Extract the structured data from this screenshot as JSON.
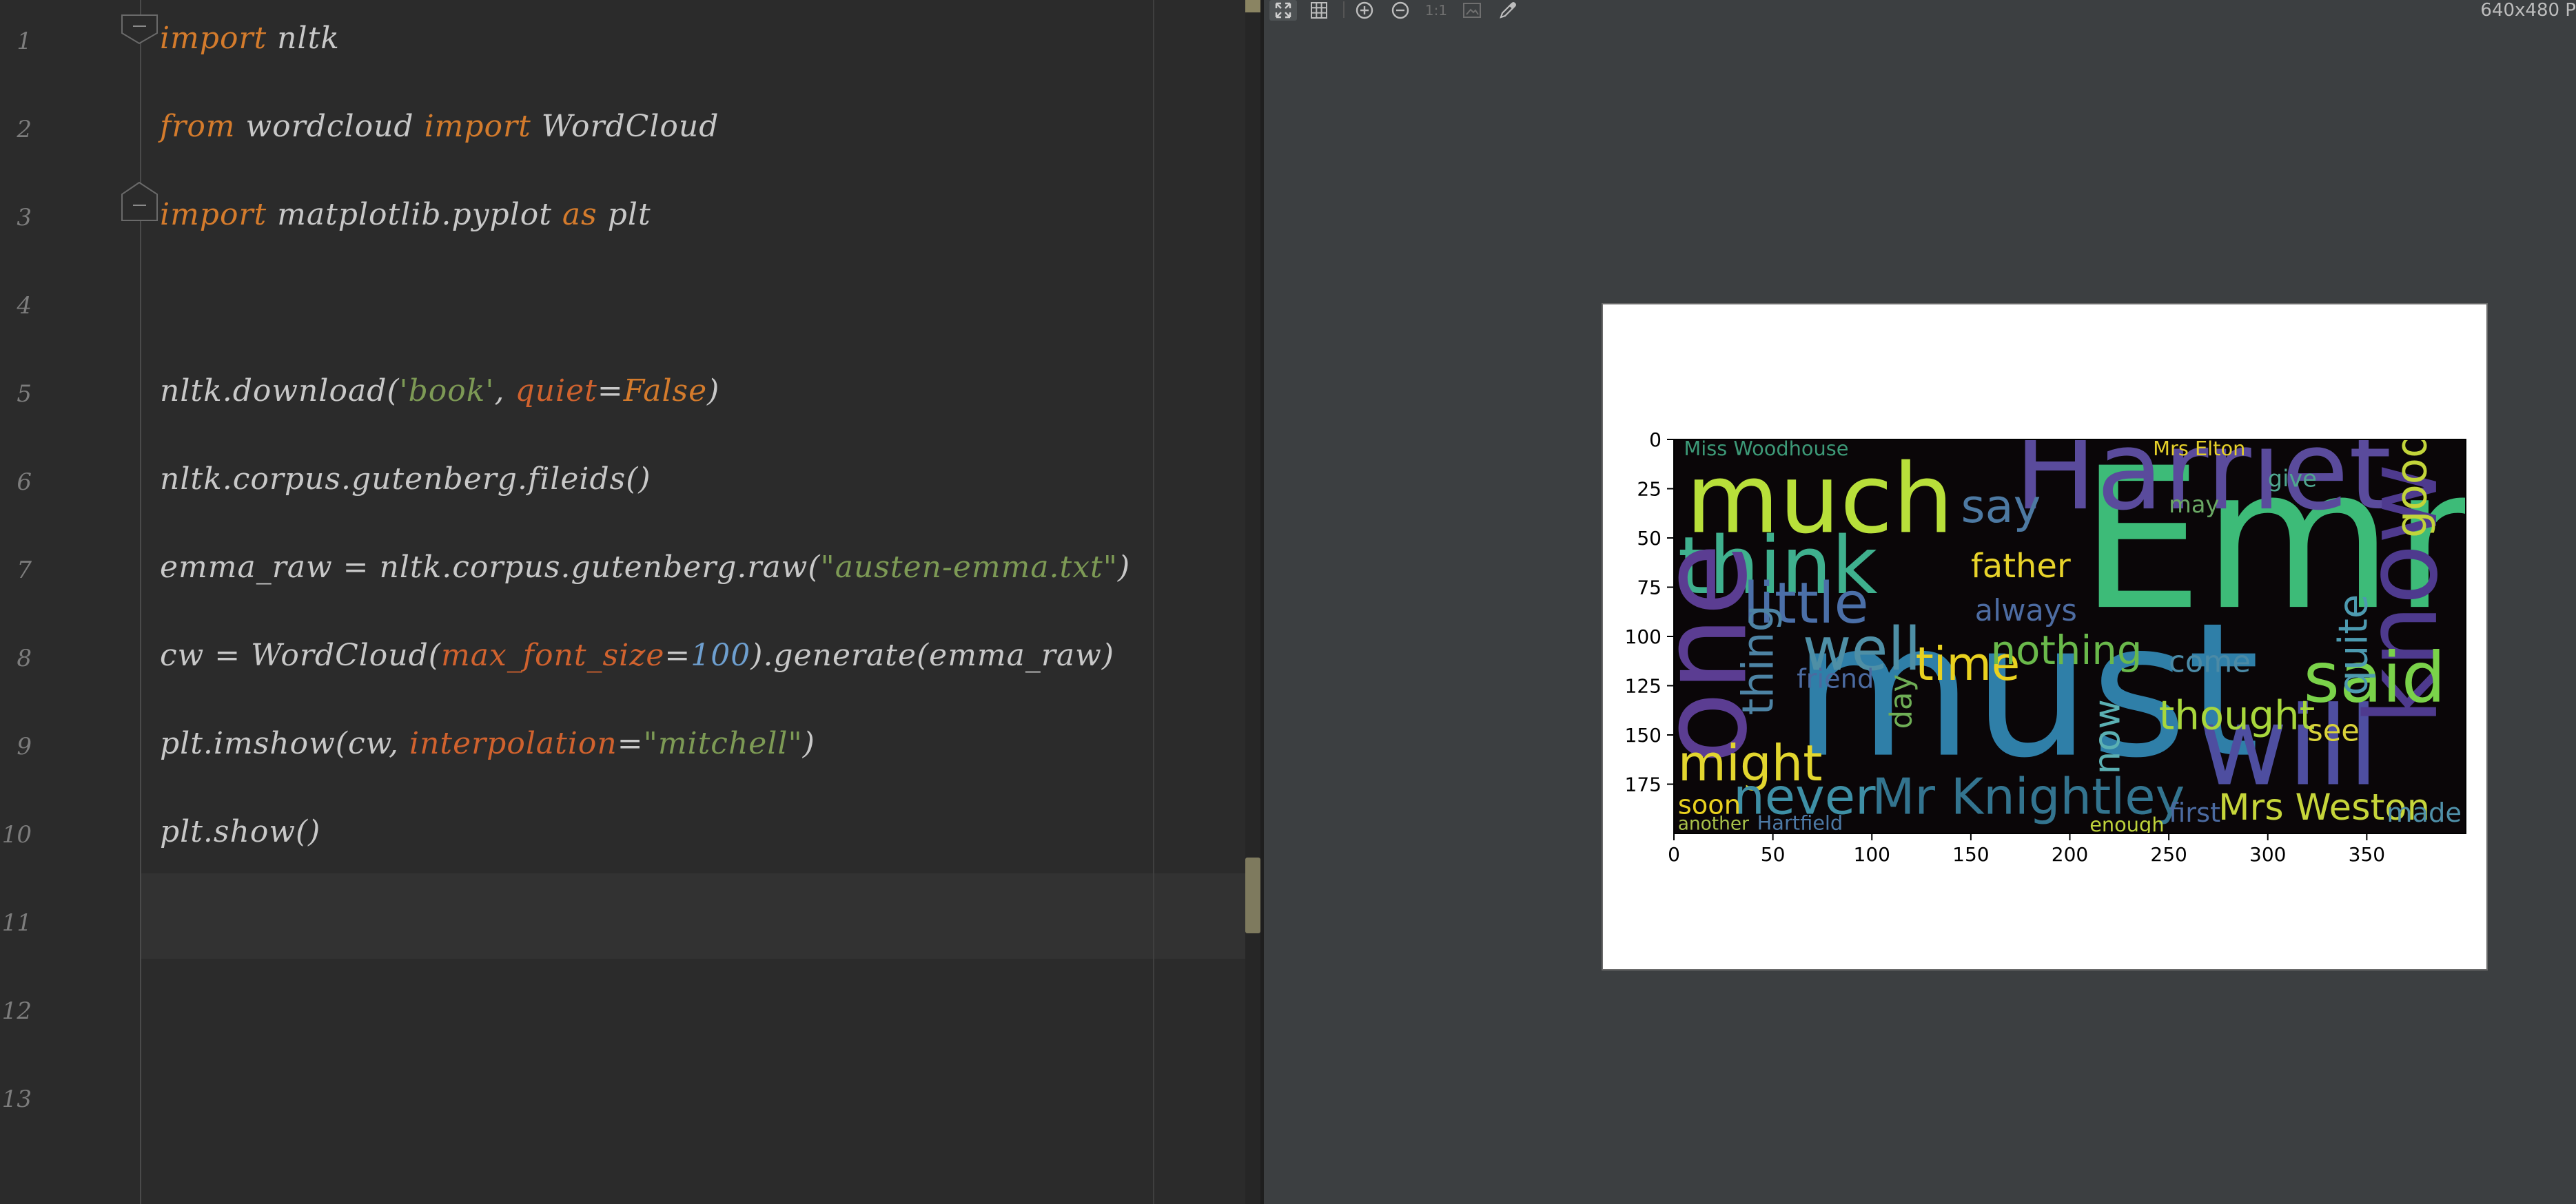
{
  "editor": {
    "line_numbers": [
      "1",
      "2",
      "3",
      "4",
      "5",
      "6",
      "7",
      "8",
      "9",
      "10",
      "11",
      "12",
      "13"
    ],
    "lines": [
      [
        {
          "t": "import",
          "c": "kw"
        },
        {
          "t": " nltk",
          "c": ""
        }
      ],
      [
        {
          "t": "from",
          "c": "kw"
        },
        {
          "t": " wordcloud ",
          "c": ""
        },
        {
          "t": "import",
          "c": "kw"
        },
        {
          "t": " WordCloud",
          "c": ""
        }
      ],
      [
        {
          "t": "import",
          "c": "kw"
        },
        {
          "t": " matplotlib.pyplot ",
          "c": ""
        },
        {
          "t": "as",
          "c": "kw"
        },
        {
          "t": " plt",
          "c": ""
        }
      ],
      [],
      [
        {
          "t": "nltk.download(",
          "c": ""
        },
        {
          "t": "'book'",
          "c": "str"
        },
        {
          "t": ", ",
          "c": ""
        },
        {
          "t": "quiet",
          "c": "prm"
        },
        {
          "t": "=",
          "c": ""
        },
        {
          "t": "False",
          "c": "kw"
        },
        {
          "t": ")",
          "c": ""
        }
      ],
      [
        {
          "t": "nltk.corpus.gutenberg.fileids()",
          "c": ""
        }
      ],
      [
        {
          "t": "emma_raw = nltk.corpus.gutenberg.raw(",
          "c": ""
        },
        {
          "t": "\"austen-emma.txt\"",
          "c": "str"
        },
        {
          "t": ")",
          "c": ""
        }
      ],
      [
        {
          "t": "cw = WordCloud(",
          "c": ""
        },
        {
          "t": "max_font_size",
          "c": "prm"
        },
        {
          "t": "=",
          "c": ""
        },
        {
          "t": "100",
          "c": "num"
        },
        {
          "t": ").generate(emma_raw)",
          "c": ""
        }
      ],
      [
        {
          "t": "plt.imshow(cw, ",
          "c": ""
        },
        {
          "t": "interpolation",
          "c": "prm"
        },
        {
          "t": "=",
          "c": ""
        },
        {
          "t": "\"mitchell\"",
          "c": "str"
        },
        {
          "t": ")",
          "c": ""
        }
      ],
      [
        {
          "t": "plt.show()",
          "c": ""
        }
      ],
      [],
      [],
      []
    ]
  },
  "viewer": {
    "toolbar": {
      "icons": [
        "fit-window-icon",
        "grid-icon",
        "zoom-in-icon",
        "zoom-out-icon",
        "actual-size-icon",
        "background-icon",
        "color-picker-icon"
      ],
      "actual_size_label": "1:1",
      "image_size": "640x480 P"
    }
  },
  "chart_data": {
    "type": "image",
    "content": "word cloud",
    "xlim": [
      0,
      400
    ],
    "ylim": [
      200,
      0
    ],
    "xticks": [
      0,
      50,
      100,
      150,
      200,
      250,
      300,
      350
    ],
    "yticks": [
      0,
      25,
      50,
      75,
      100,
      125,
      150,
      175
    ],
    "words": [
      {
        "text": "Emma",
        "x": 205,
        "y": 85,
        "size": 118,
        "color": "#3dbb78",
        "rot": 0
      },
      {
        "text": "must",
        "x": 60,
        "y": 160,
        "size": 112,
        "color": "#2f7fa8",
        "rot": 0
      },
      {
        "text": "Harriet",
        "x": 172,
        "y": 35,
        "size": 66,
        "color": "#5a4b9c",
        "rot": 0
      },
      {
        "text": "much",
        "x": 6,
        "y": 47,
        "size": 58,
        "color": "#b8df3a",
        "rot": 0
      },
      {
        "text": "think",
        "x": 2,
        "y": 78,
        "size": 48,
        "color": "#3fb08e",
        "rot": 0
      },
      {
        "text": "will",
        "x": 265,
        "y": 175,
        "size": 66,
        "color": "#4e4ea0",
        "rot": 0
      },
      {
        "text": "one",
        "x": 36,
        "y": 165,
        "size": 72,
        "color": "#5b3d92",
        "rot": -90
      },
      {
        "text": "know",
        "x": 385,
        "y": 145,
        "size": 60,
        "color": "#4e3a8e",
        "rot": -90
      },
      {
        "text": "little",
        "x": 35,
        "y": 93,
        "size": 34,
        "color": "#4b6fa8",
        "rot": 0
      },
      {
        "text": "well",
        "x": 65,
        "y": 117,
        "size": 36,
        "color": "#4e8fa6",
        "rot": 0
      },
      {
        "text": "said",
        "x": 318,
        "y": 133,
        "size": 42,
        "color": "#7ad24a",
        "rot": 0
      },
      {
        "text": "might",
        "x": 2,
        "y": 173,
        "size": 30,
        "color": "#e3d62e",
        "rot": 0
      },
      {
        "text": "never",
        "x": 30,
        "y": 190,
        "size": 30,
        "color": "#3e8fa5",
        "rot": 0
      },
      {
        "text": "Mr Knightley",
        "x": 100,
        "y": 190,
        "size": 30,
        "color": "#33748f",
        "rot": 0
      },
      {
        "text": "time",
        "x": 122,
        "y": 122,
        "size": 28,
        "color": "#e9d11f",
        "rot": 0
      },
      {
        "text": "nothing",
        "x": 160,
        "y": 114,
        "size": 24,
        "color": "#6ab94b",
        "rot": 0
      },
      {
        "text": "thought",
        "x": 245,
        "y": 147,
        "size": 24,
        "color": "#a8d73c",
        "rot": 0
      },
      {
        "text": "say",
        "x": 145,
        "y": 42,
        "size": 28,
        "color": "#4d79a2",
        "rot": 0
      },
      {
        "text": "good",
        "x": 380,
        "y": 50,
        "size": 26,
        "color": "#c2d43a",
        "rot": -90
      },
      {
        "text": "Mrs Weston",
        "x": 275,
        "y": 193,
        "size": 22,
        "color": "#c6d53a",
        "rot": 0
      },
      {
        "text": "father",
        "x": 150,
        "y": 70,
        "size": 20,
        "color": "#e8d32a",
        "rot": 0
      },
      {
        "text": "thing",
        "x": 50,
        "y": 140,
        "size": 26,
        "color": "#4d83a4",
        "rot": -90
      },
      {
        "text": "quite",
        "x": 350,
        "y": 130,
        "size": 24,
        "color": "#4d9ab0",
        "rot": -90
      },
      {
        "text": "Miss Woodhouse",
        "x": 5,
        "y": 8,
        "size": 12,
        "color": "#3d9a78",
        "rot": 0
      },
      {
        "text": "friend",
        "x": 62,
        "y": 126,
        "size": 16,
        "color": "#4b6aa0",
        "rot": 0
      },
      {
        "text": "made",
        "x": 360,
        "y": 194,
        "size": 16,
        "color": "#4f90a9",
        "rot": 0
      },
      {
        "text": "first",
        "x": 250,
        "y": 194,
        "size": 16,
        "color": "#4b6aa0",
        "rot": 0
      },
      {
        "text": "soon",
        "x": 2,
        "y": 190,
        "size": 16,
        "color": "#e9d11f",
        "rot": 0
      },
      {
        "text": "always",
        "x": 152,
        "y": 92,
        "size": 18,
        "color": "#4d6ca2",
        "rot": 0
      },
      {
        "text": "Hartfield",
        "x": 42,
        "y": 198,
        "size": 12,
        "color": "#4d7aa6",
        "rot": 0
      },
      {
        "text": "Mrs Elton",
        "x": 242,
        "y": 8,
        "size": 12,
        "color": "#e6d12a",
        "rot": 0
      },
      {
        "text": "come",
        "x": 250,
        "y": 118,
        "size": 18,
        "color": "#4b8aa6",
        "rot": 0
      },
      {
        "text": "see",
        "x": 320,
        "y": 153,
        "size": 18,
        "color": "#d9d23a",
        "rot": 0
      },
      {
        "text": "day",
        "x": 120,
        "y": 147,
        "size": 18,
        "color": "#6fae56",
        "rot": -90
      },
      {
        "text": "now",
        "x": 225,
        "y": 170,
        "size": 22,
        "color": "#5bb0b3",
        "rot": -90
      },
      {
        "text": "give",
        "x": 300,
        "y": 24,
        "size": 14,
        "color": "#4fa68f",
        "rot": 0
      },
      {
        "text": "may",
        "x": 250,
        "y": 37,
        "size": 14,
        "color": "#6aa864",
        "rot": 0
      },
      {
        "text": "enough",
        "x": 210,
        "y": 199,
        "size": 12,
        "color": "#bfd43b",
        "rot": 0
      },
      {
        "text": "another",
        "x": 2,
        "y": 198,
        "size": 11,
        "color": "#a8c24a",
        "rot": 0
      }
    ]
  }
}
